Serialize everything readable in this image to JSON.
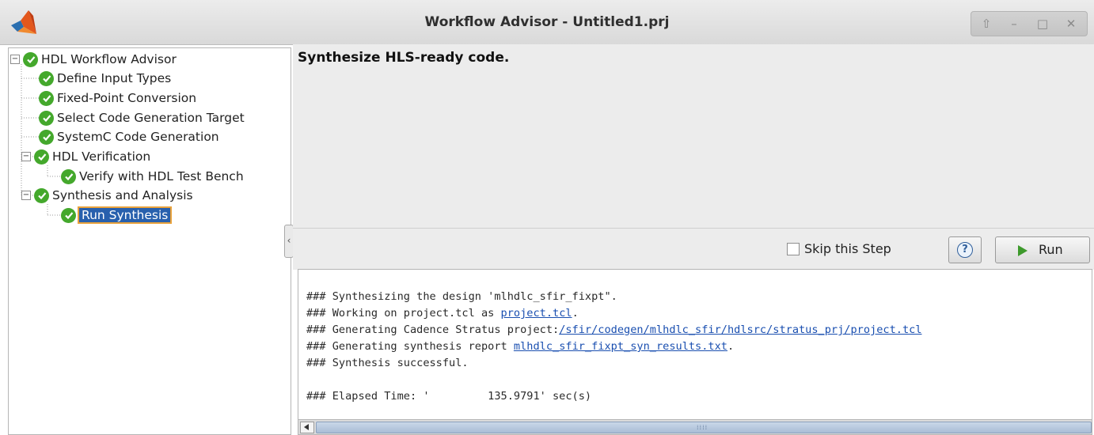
{
  "window": {
    "title": "Workflow Advisor - Untitled1.prj",
    "controls": [
      {
        "name": "up-arrow-icon",
        "glyph": "⇧"
      },
      {
        "name": "minimize-icon",
        "glyph": "–"
      },
      {
        "name": "maximize-icon",
        "glyph": "□"
      },
      {
        "name": "close-icon",
        "glyph": "✕"
      }
    ]
  },
  "tree": {
    "items": [
      {
        "label": "HDL Workflow Advisor",
        "expander": "−",
        "status": "passed"
      },
      {
        "label": "Define Input Types",
        "status": "passed"
      },
      {
        "label": "Fixed-Point Conversion",
        "status": "passed"
      },
      {
        "label": "Select Code Generation Target",
        "status": "passed"
      },
      {
        "label": "SystemC Code Generation",
        "status": "passed"
      },
      {
        "label": "HDL Verification",
        "expander": "−",
        "status": "passed"
      },
      {
        "label": "Verify with HDL Test Bench",
        "status": "passed"
      },
      {
        "label": "Synthesis and Analysis",
        "expander": "−",
        "status": "passed"
      },
      {
        "label": "Run Synthesis",
        "status": "passed",
        "selected": true
      }
    ],
    "collapse_glyph": "‹"
  },
  "task": {
    "description": "Synthesize HLS-ready code."
  },
  "actions": {
    "skip_label": "Skip this Step",
    "skip_checked": false,
    "help_label": "?",
    "run_label": "Run"
  },
  "log": {
    "lines": [
      {
        "prefix": "### Synthesizing the design 'mlhdlc_sfir_fixpt\".",
        "link": "",
        "suffix": ""
      },
      {
        "prefix": "### Working on project.tcl as ",
        "link": "project.tcl",
        "suffix": "."
      },
      {
        "prefix": "### Generating Cadence Stratus project:",
        "link": "/sfir/codegen/mlhdlc_sfir/hdlsrc/stratus_prj/project.tcl",
        "suffix": ""
      },
      {
        "prefix": "### Generating synthesis report ",
        "link": "mlhdlc_sfir_fixpt_syn_results.txt",
        "suffix": "."
      },
      {
        "prefix": "### Synthesis successful.",
        "link": "",
        "suffix": ""
      },
      {
        "prefix": "",
        "link": "",
        "suffix": ""
      },
      {
        "prefix": "### Elapsed Time: '         135.9791' sec(s)",
        "link": "",
        "suffix": ""
      }
    ]
  },
  "colors": {
    "check_green": "#44a82c",
    "selection_blue": "#2860ad",
    "selection_outline": "#e9a23b",
    "link_blue": "#1a4fb0"
  }
}
